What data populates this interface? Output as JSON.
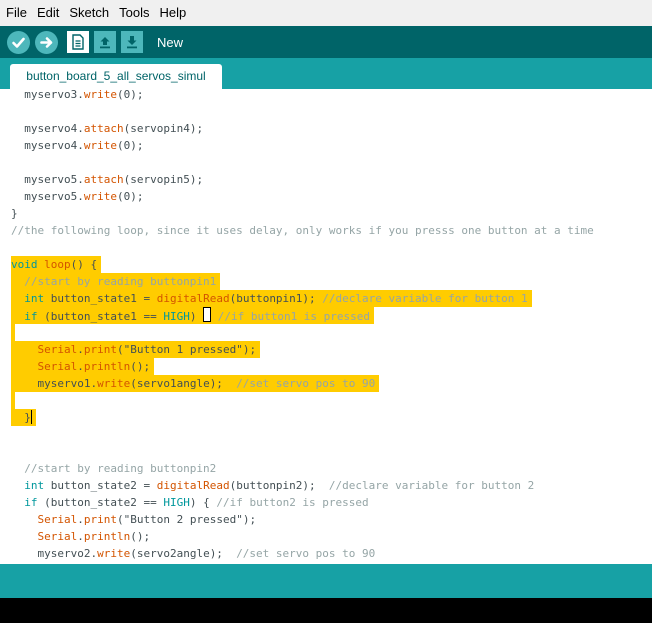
{
  "menu": {
    "items": [
      "File",
      "Edit",
      "Sketch",
      "Tools",
      "Help"
    ]
  },
  "toolbar": {
    "label": "New",
    "buttons": [
      "verify-icon",
      "upload-icon",
      "new-icon",
      "open-icon",
      "save-icon"
    ]
  },
  "tab": {
    "label": "button_board_5_all_servos_simul"
  },
  "code": {
    "l0": "  myservo3.write(0);",
    "l2": "  myservo4.attach(servopin4);",
    "l3": "  myservo4.write(0);",
    "l5": "  myservo5.attach(servopin5);",
    "l6": "  myservo5.write(0);",
    "l7": "}",
    "l8": "//the following loop, since it uses delay, only works if you presss one button at a time",
    "l10": "void loop() {",
    "l11": "  //start by reading buttonpin1",
    "l12": "  int button_state1 = digitalRead(buttonpin1); //declare variable for button 1",
    "l13": "  if (button_state1 == HIGH) { //if button1 is pressed",
    "l15": "    Serial.print(\"Button 1 pressed\");",
    "l16": "    Serial.println();",
    "l17": "    myservo1.write(servo1angle);  //set servo pos to 90",
    "l19": "  }",
    "l22": "  //start by reading buttonpin2",
    "l23": "  int button_state2 = digitalRead(buttonpin2);  //declare variable for button 2",
    "l24": "  if (button_state2 == HIGH) { //if button2 is pressed",
    "l25": "    Serial.print(\"Button 2 pressed\");",
    "l26": "    Serial.println();",
    "l27": "    myservo2.write(servo2angle);  //set servo pos to 90"
  },
  "colors": {
    "toolbar": "#006468",
    "tabbar": "#17a1a5",
    "highlight": "#ffcc00",
    "function": "#d35400",
    "keyword": "#00979c",
    "comment": "#95a5a6"
  }
}
